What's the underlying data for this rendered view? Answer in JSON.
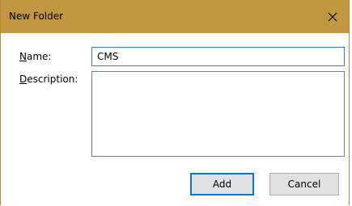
{
  "window": {
    "title": "New Folder",
    "close_icon": "close-icon",
    "titlebar_color": "#c09740"
  },
  "form": {
    "name_label": {
      "mnemonic": "N",
      "rest": "ame:"
    },
    "name_value": "CMS",
    "description_label": {
      "mnemonic": "D",
      "rest": "escription:"
    },
    "description_value": ""
  },
  "buttons": {
    "add_label": "Add",
    "cancel_label": "Cancel"
  },
  "colors": {
    "focus_border": "#3a7fd4",
    "default_button_border": "#0078d7"
  }
}
